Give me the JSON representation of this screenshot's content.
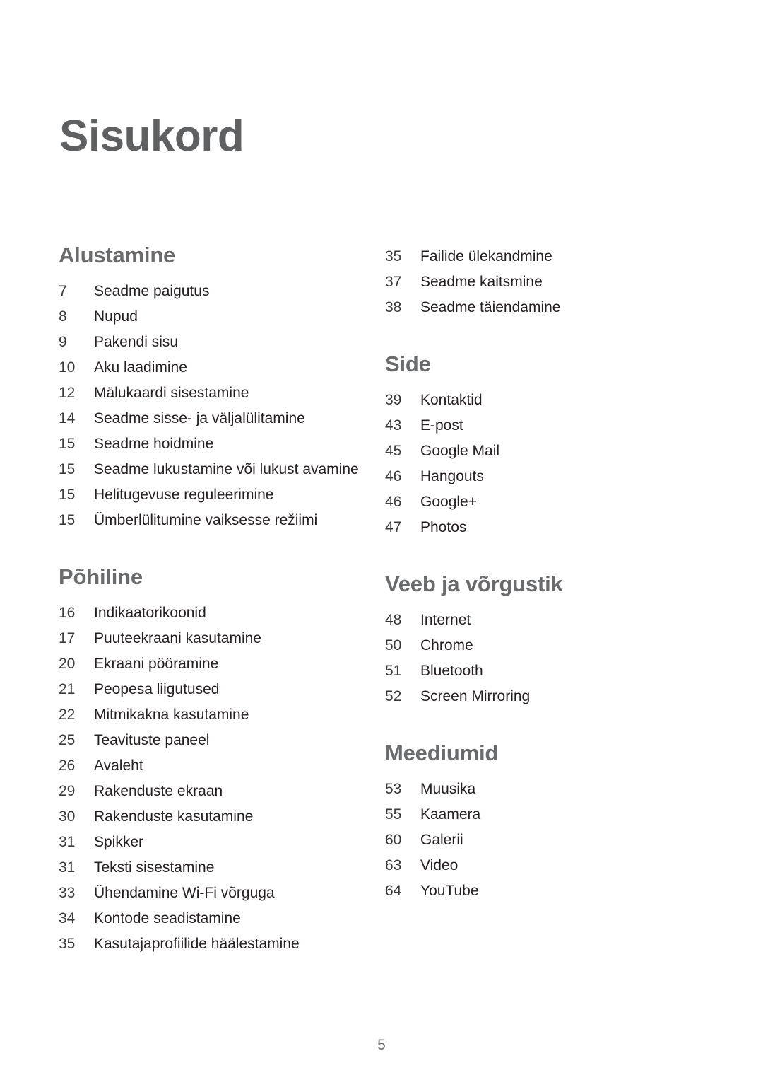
{
  "document": {
    "title": "Sisukord",
    "footer_page_number": "5",
    "colors": {
      "title": "#5f6062",
      "section_heading": "#6a6b6d",
      "entry_label": "#262022",
      "entry_page": "#3a3a3c",
      "footer": "#6f7377",
      "background": "#ffffff"
    }
  },
  "columns": [
    {
      "id": "left",
      "sections": [
        {
          "heading": "Alustamine",
          "has_heading": true,
          "entries": [
            {
              "page": "7",
              "label": "Seadme paigutus"
            },
            {
              "page": "8",
              "label": "Nupud"
            },
            {
              "page": "9",
              "label": "Pakendi sisu"
            },
            {
              "page": "10",
              "label": "Aku laadimine"
            },
            {
              "page": "12",
              "label": "Mälukaardi sisestamine"
            },
            {
              "page": "14",
              "label": "Seadme sisse- ja väljalülitamine"
            },
            {
              "page": "15",
              "label": "Seadme hoidmine"
            },
            {
              "page": "15",
              "label": "Seadme lukustamine või lukust avamine"
            },
            {
              "page": "15",
              "label": "Helitugevuse reguleerimine"
            },
            {
              "page": "15",
              "label": "Ümberlülitumine vaiksesse režiimi"
            }
          ]
        },
        {
          "heading": "Põhiline",
          "has_heading": true,
          "entries": [
            {
              "page": "16",
              "label": "Indikaatorikoonid"
            },
            {
              "page": "17",
              "label": "Puuteekraani kasutamine"
            },
            {
              "page": "20",
              "label": "Ekraani pööramine"
            },
            {
              "page": "21",
              "label": "Peopesa liigutused"
            },
            {
              "page": "22",
              "label": "Mitmikakna kasutamine"
            },
            {
              "page": "25",
              "label": "Teavituste paneel"
            },
            {
              "page": "26",
              "label": "Avaleht"
            },
            {
              "page": "29",
              "label": "Rakenduste ekraan"
            },
            {
              "page": "30",
              "label": "Rakenduste kasutamine"
            },
            {
              "page": "31",
              "label": "Spikker"
            },
            {
              "page": "31",
              "label": "Teksti sisestamine"
            },
            {
              "page": "33",
              "label": "Ühendamine Wi-Fi võrguga"
            },
            {
              "page": "34",
              "label": "Kontode seadistamine"
            },
            {
              "page": "35",
              "label": "Kasutajaprofiilide häälestamine"
            }
          ]
        }
      ]
    },
    {
      "id": "right",
      "sections": [
        {
          "heading": "",
          "has_heading": false,
          "entries": [
            {
              "page": "35",
              "label": "Failide ülekandmine"
            },
            {
              "page": "37",
              "label": "Seadme kaitsmine"
            },
            {
              "page": "38",
              "label": "Seadme täiendamine"
            }
          ]
        },
        {
          "heading": "Side",
          "has_heading": true,
          "entries": [
            {
              "page": "39",
              "label": "Kontaktid"
            },
            {
              "page": "43",
              "label": "E-post"
            },
            {
              "page": "45",
              "label": "Google Mail"
            },
            {
              "page": "46",
              "label": "Hangouts"
            },
            {
              "page": "46",
              "label": "Google+"
            },
            {
              "page": "47",
              "label": "Photos"
            }
          ]
        },
        {
          "heading": "Veeb ja võrgustik",
          "has_heading": true,
          "entries": [
            {
              "page": "48",
              "label": "Internet"
            },
            {
              "page": "50",
              "label": "Chrome"
            },
            {
              "page": "51",
              "label": "Bluetooth"
            },
            {
              "page": "52",
              "label": "Screen Mirroring"
            }
          ]
        },
        {
          "heading": "Meediumid",
          "has_heading": true,
          "entries": [
            {
              "page": "53",
              "label": "Muusika"
            },
            {
              "page": "55",
              "label": "Kaamera"
            },
            {
              "page": "60",
              "label": "Galerii"
            },
            {
              "page": "63",
              "label": "Video"
            },
            {
              "page": "64",
              "label": "YouTube"
            }
          ]
        }
      ]
    }
  ]
}
